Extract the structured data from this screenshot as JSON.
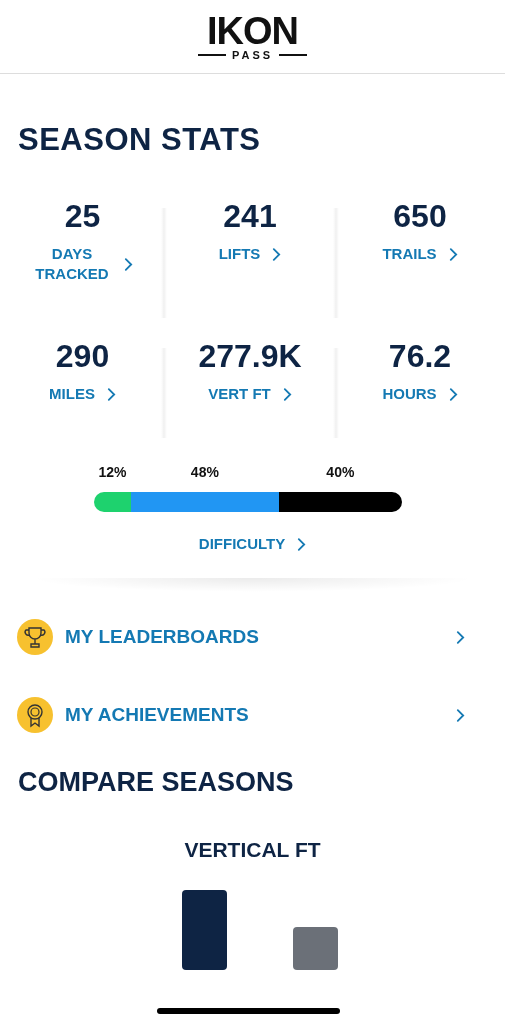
{
  "header": {
    "logo_word": "IKON",
    "logo_sub": "PASS"
  },
  "season_stats": {
    "title": "SEASON STATS",
    "stats": [
      {
        "value": "25",
        "label": "DAYS TRACKED"
      },
      {
        "value": "241",
        "label": "LIFTS"
      },
      {
        "value": "650",
        "label": "TRAILS"
      },
      {
        "value": "290",
        "label": "MILES"
      },
      {
        "value": "277.9K",
        "label": "VERT FT"
      },
      {
        "value": "76.2",
        "label": "HOURS"
      }
    ],
    "difficulty": {
      "segments": [
        {
          "percent": "12%",
          "color": "#1ed26e"
        },
        {
          "percent": "48%",
          "color": "#2196f3"
        },
        {
          "percent": "40%",
          "color": "#000000"
        }
      ],
      "label": "DIFFICULTY"
    }
  },
  "links": [
    {
      "kind": "trophy",
      "label": "MY LEADERBOARDS"
    },
    {
      "kind": "ribbon",
      "label": "MY ACHIEVEMENTS"
    }
  ],
  "compare": {
    "title": "COMPARE SEASONS",
    "chart_title": "VERTICAL FT"
  }
}
